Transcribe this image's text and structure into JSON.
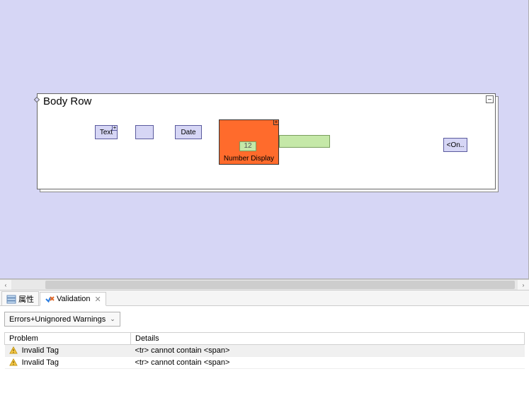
{
  "canvas": {
    "container_title": "Body Row",
    "collapse_glyph": "–",
    "widgets": {
      "text_label": "Text",
      "date_label": "Date",
      "number_value": "12",
      "number_label": "Number Display",
      "on_label": "<On..",
      "plus_glyph": "+"
    }
  },
  "scroll": {
    "left_glyph": "‹",
    "right_glyph": "›"
  },
  "tabs": {
    "properties": {
      "label": "属性"
    },
    "validation": {
      "label": "Validation",
      "close_glyph": "✕"
    }
  },
  "validation_panel": {
    "filter_label": "Errors+Unignored Warnings",
    "columns": {
      "problem": "Problem",
      "details": "Details"
    },
    "rows": [
      {
        "problem": "Invalid Tag",
        "details": "<tr> cannot contain <span>"
      },
      {
        "problem": "Invalid Tag",
        "details": "<tr> cannot contain <span>"
      }
    ]
  }
}
